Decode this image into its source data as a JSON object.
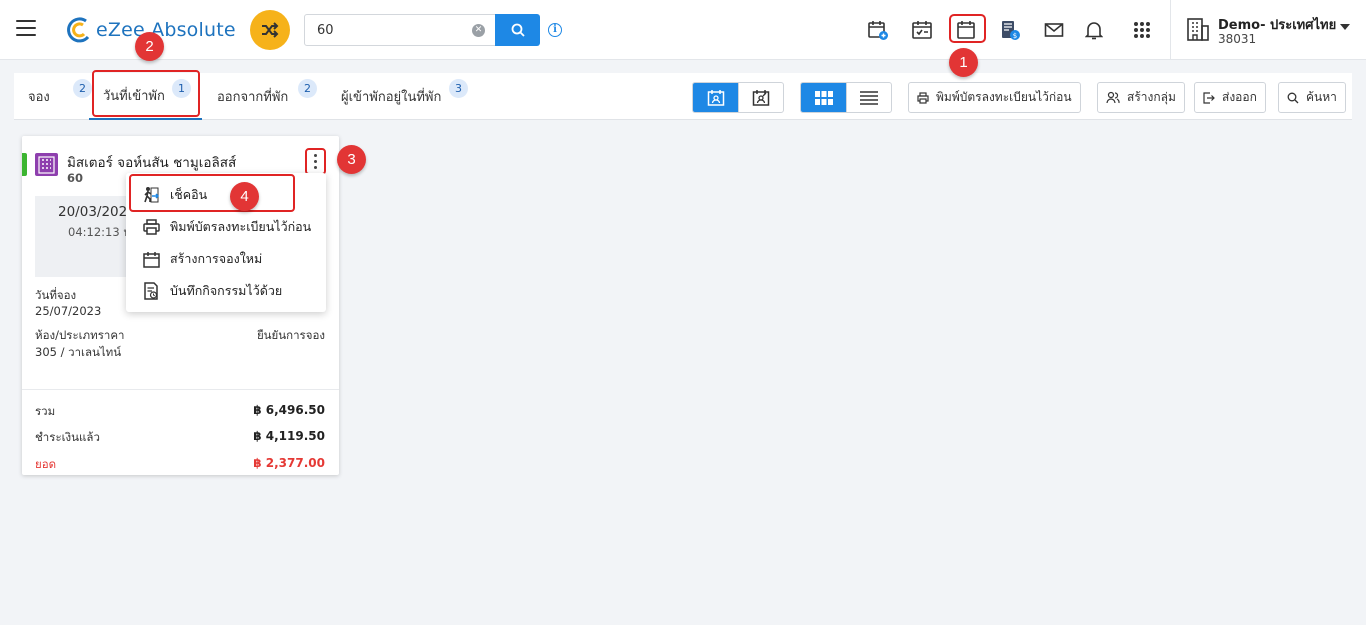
{
  "header": {
    "logo_text": "eZee Absolute",
    "search_value": "60",
    "property_name": "Demo- ประเทศไทย",
    "property_id": "38031",
    "icons": [
      "new-reservation-icon",
      "checkin-calendar-icon",
      "calendar-icon",
      "billing-icon",
      "mail-icon",
      "bell-icon",
      "apps-grid-icon"
    ]
  },
  "tabs": [
    {
      "label": "จอง",
      "count": "2"
    },
    {
      "label": "วันที่เข้าพัก",
      "count": "1"
    },
    {
      "label": "ออกจากที่พัก",
      "count": "2"
    },
    {
      "label": "ผู้เข้าพักอยู่ในที่พัก",
      "count": "3"
    }
  ],
  "toolbar": {
    "print_label": "พิมพ์บัตรลงทะเบียนไว้ก่อน",
    "group_label": "สร้างกลุ่ม",
    "export_label": "ส่งออก",
    "search_label": "ค้นหา"
  },
  "card": {
    "guest_name": "มิสเตอร์ จอห์นสัน ชามูเอลิสส์",
    "res_no": "60",
    "date": "20/03/2023",
    "time": "04:12:13 น",
    "booking_date_label": "วันที่จอง",
    "booking_date": "25/07/2023",
    "room_label": "ห้อง/ประเภทราคา",
    "room_value": "305 / วาเลนไทน์",
    "status": "ยืนยันการจอง",
    "total_label": "รวม",
    "total_value": "฿ 6,496.50",
    "paid_label": "ชำระเงินแล้ว",
    "paid_value": "฿ 4,119.50",
    "balance_label": "ยอด",
    "balance_value": "฿ 2,377.00"
  },
  "menu": {
    "items": [
      {
        "label": "เช็คอิน"
      },
      {
        "label": "พิมพ์บัตรลงทะเบียนไว้ก่อน"
      },
      {
        "label": "สร้างการจองใหม่"
      },
      {
        "label": "บันทึกกิจกรรมไว้ด้วย"
      }
    ]
  },
  "steps": [
    "1",
    "2",
    "3",
    "4"
  ],
  "colors": {
    "accent": "#1e88e5",
    "highlight": "#e02424",
    "status_green": "#3cb531",
    "balance_red": "#e53935"
  }
}
